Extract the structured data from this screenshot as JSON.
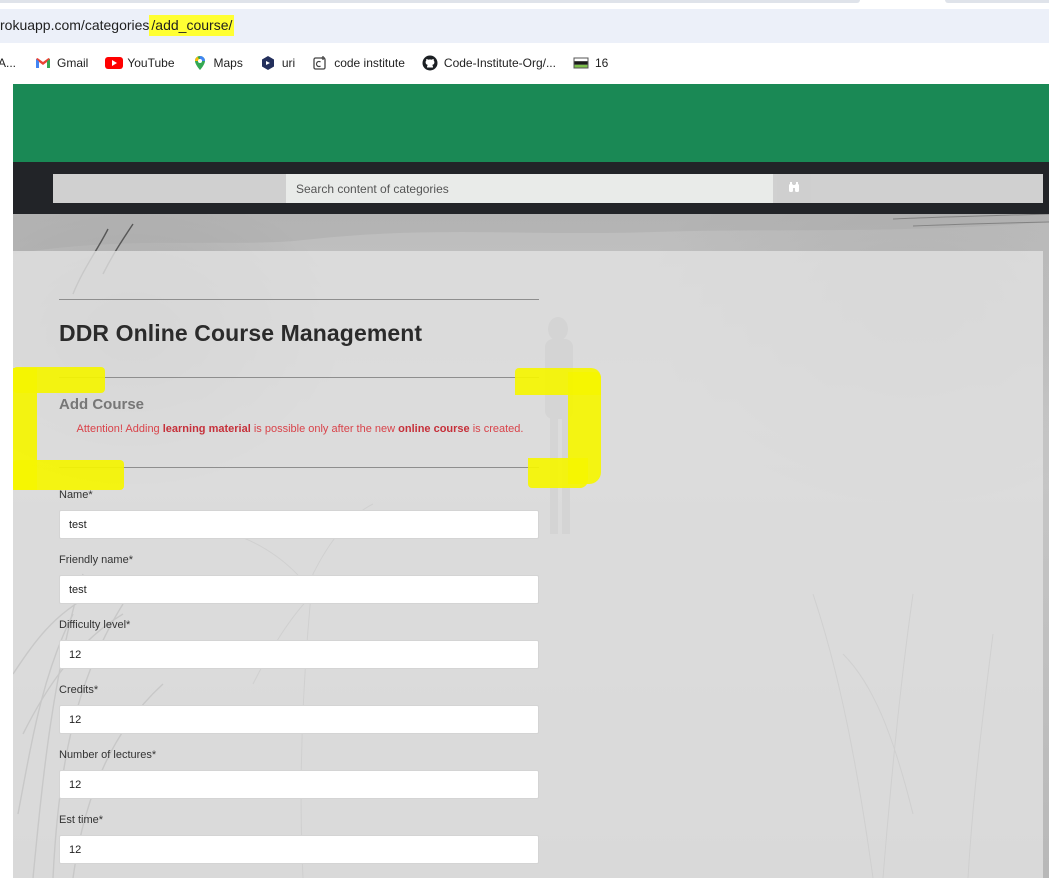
{
  "browser": {
    "url_prefix": "rokuapp.com/categories",
    "url_highlight": "/add_course/",
    "bookmarks": [
      {
        "label": "A...",
        "icon": "bookmark-icon"
      },
      {
        "label": "Gmail",
        "icon": "gmail-icon"
      },
      {
        "label": "YouTube",
        "icon": "youtube-icon"
      },
      {
        "label": "Maps",
        "icon": "maps-icon"
      },
      {
        "label": "uri",
        "icon": "uri-icon"
      },
      {
        "label": "code institute",
        "icon": "code-institute-icon"
      },
      {
        "label": "Code-Institute-Org/...",
        "icon": "github-icon"
      },
      {
        "label": "16",
        "icon": "flag-icon"
      }
    ]
  },
  "search": {
    "placeholder": "Search content of categories",
    "button_icon": "binoculars-icon"
  },
  "main": {
    "title": "DDR Online Course Management",
    "section": "Add Course",
    "attention": {
      "part1": "Attention! Adding ",
      "bold1": "learning material",
      "part2": " is possible only after the new ",
      "bold2": "online course",
      "part3": " is created."
    },
    "fields": [
      {
        "label": "Name*",
        "value": "test"
      },
      {
        "label": "Friendly name*",
        "value": "test"
      },
      {
        "label": "Difficulty level*",
        "value": "12"
      },
      {
        "label": "Credits*",
        "value": "12"
      },
      {
        "label": "Number of lectures*",
        "value": "12"
      },
      {
        "label": "Est time*",
        "value": "12"
      }
    ]
  },
  "colors": {
    "header_green": "#1a8955",
    "search_strip": "#222428",
    "attention_red": "#d9434a",
    "annotation_yellow": "#f5f500"
  }
}
